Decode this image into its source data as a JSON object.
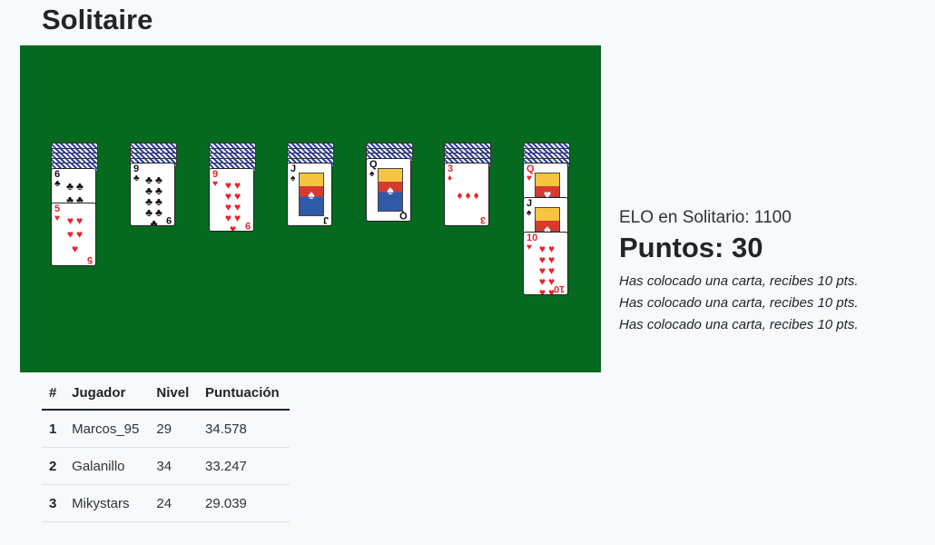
{
  "page": {
    "title": "Solitaire"
  },
  "colors": {
    "felt": "#056a1f",
    "background": "#f8f9fa",
    "red_suit": "#e8252b",
    "card_back": "#2c3ea6"
  },
  "game": {
    "piles": [
      {
        "hidden": 5,
        "cards": [
          {
            "rank": "6",
            "suit": "♣",
            "color": "black"
          },
          {
            "rank": "5",
            "suit": "♥",
            "color": "red"
          }
        ]
      },
      {
        "hidden": 4,
        "cards": [
          {
            "rank": "9",
            "suit": "♣",
            "color": "black"
          }
        ]
      },
      {
        "hidden": 5,
        "cards": [
          {
            "rank": "9",
            "suit": "♥",
            "color": "red"
          }
        ]
      },
      {
        "hidden": 4,
        "cards": [
          {
            "rank": "J",
            "suit": "♠",
            "color": "black"
          }
        ]
      },
      {
        "hidden": 3,
        "cards": [
          {
            "rank": "Q",
            "suit": "♠",
            "color": "black"
          }
        ]
      },
      {
        "hidden": 4,
        "cards": [
          {
            "rank": "3",
            "suit": "♦",
            "color": "red"
          }
        ]
      },
      {
        "hidden": 4,
        "cards": [
          {
            "rank": "Q",
            "suit": "♥",
            "color": "red"
          },
          {
            "rank": "J",
            "suit": "♠",
            "color": "black"
          },
          {
            "rank": "10",
            "suit": "♥",
            "color": "red"
          }
        ]
      }
    ]
  },
  "info": {
    "elo": "ELO en Solitario: 1100",
    "points": "Puntos: 30",
    "log": [
      "Has colocado una carta, recibes 10 pts.",
      "Has colocado una carta, recibes 10 pts.",
      "Has colocado una carta, recibes 10 pts."
    ]
  },
  "leaderboard": {
    "headers": [
      "#",
      "Jugador",
      "Nivel",
      "Puntuación"
    ],
    "rows": [
      {
        "rank": "1",
        "player": "Marcos_95",
        "level": "29",
        "score": "34.578"
      },
      {
        "rank": "2",
        "player": "Galanillo",
        "level": "34",
        "score": "33.247"
      },
      {
        "rank": "3",
        "player": "Mikystars",
        "level": "24",
        "score": "29.039"
      }
    ]
  }
}
